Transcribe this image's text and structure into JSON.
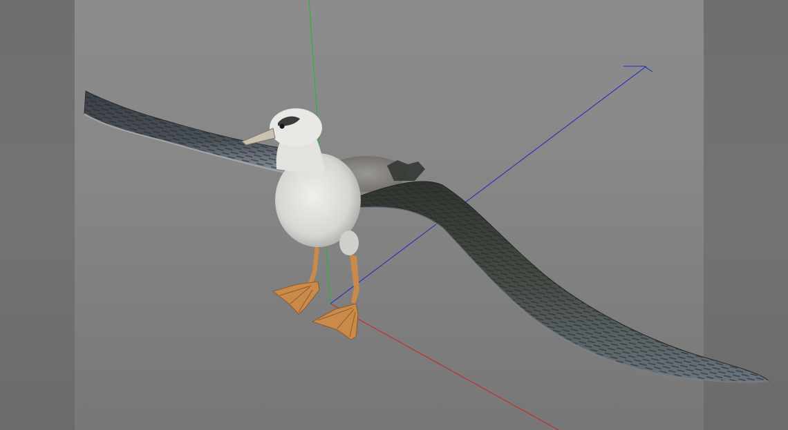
{
  "viewport": {
    "name": "3D viewport",
    "background_color": "#888888",
    "side_band_color": "#6f6f6f"
  },
  "axes": {
    "x_axis_color": "#cc2222",
    "y_axis_color": "#22bb22",
    "z_axis_color": "#2222cc"
  },
  "model": {
    "subject": "albatross",
    "body_color": "#d9d9d6",
    "wing_color": "#3a3f3a",
    "feet_color": "#c98a4a",
    "beak_color": "#c9c2b0"
  }
}
